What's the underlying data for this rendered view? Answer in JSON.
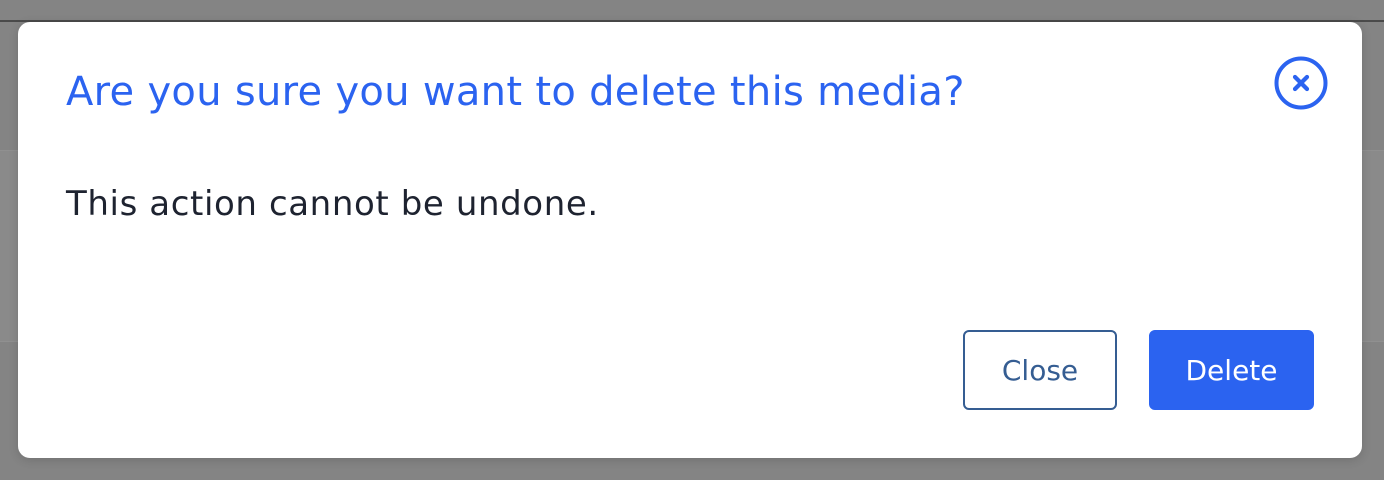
{
  "dialog": {
    "title": "Are you sure you want to delete this media?",
    "message": "This action cannot be undone.",
    "close_icon": "close-circle-icon",
    "buttons": {
      "close_label": "Close",
      "delete_label": "Delete"
    }
  },
  "colors": {
    "accent": "#2b63f0",
    "secondary_button_border": "#355d92",
    "body_text": "#1e2330",
    "overlay": "#848484"
  }
}
